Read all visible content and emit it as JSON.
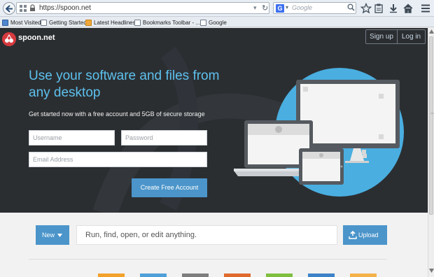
{
  "browser": {
    "url": "https://spoon.net",
    "search_placeholder": "Google",
    "search_engine_logo": "G",
    "bookmarks": [
      {
        "label": "Most Visited",
        "icon": "bookmark-page-icon"
      },
      {
        "label": "Getting Started",
        "icon": "page-icon"
      },
      {
        "label": "Latest Headlines",
        "icon": "rss-icon"
      },
      {
        "label": "Bookmarks Toolbar - ...",
        "icon": "page-icon"
      },
      {
        "label": "Google",
        "icon": "page-icon"
      }
    ],
    "toolbar_icons": [
      "star-icon",
      "clipboard-icon",
      "download-icon",
      "home-icon",
      "menu-icon"
    ]
  },
  "header": {
    "brand": "spoon.net",
    "sign_up": "Sign up",
    "log_in": "Log in"
  },
  "hero": {
    "headline": "Use your software and files from any desktop",
    "subline": "Get started now with a free account and 5GB of secure storage",
    "username_placeholder": "Username",
    "password_placeholder": "Password",
    "email_placeholder": "Email Address",
    "create_button": "Create Free Account"
  },
  "commandbar": {
    "new_button": "New",
    "placeholder": "Run, find, open, or edit anything.",
    "upload_button": "Upload"
  },
  "colors": {
    "accent": "#4b95ca",
    "headline": "#5dc1ee",
    "hero_bg": "#2b2e31",
    "logo_red": "#d63a3f",
    "tiles": [
      "#f2a12a",
      "#4fa0d8",
      "#7e7e7e",
      "#e06a2c",
      "#7fbf3f",
      "#3d83c7",
      "#f4b24a"
    ]
  }
}
